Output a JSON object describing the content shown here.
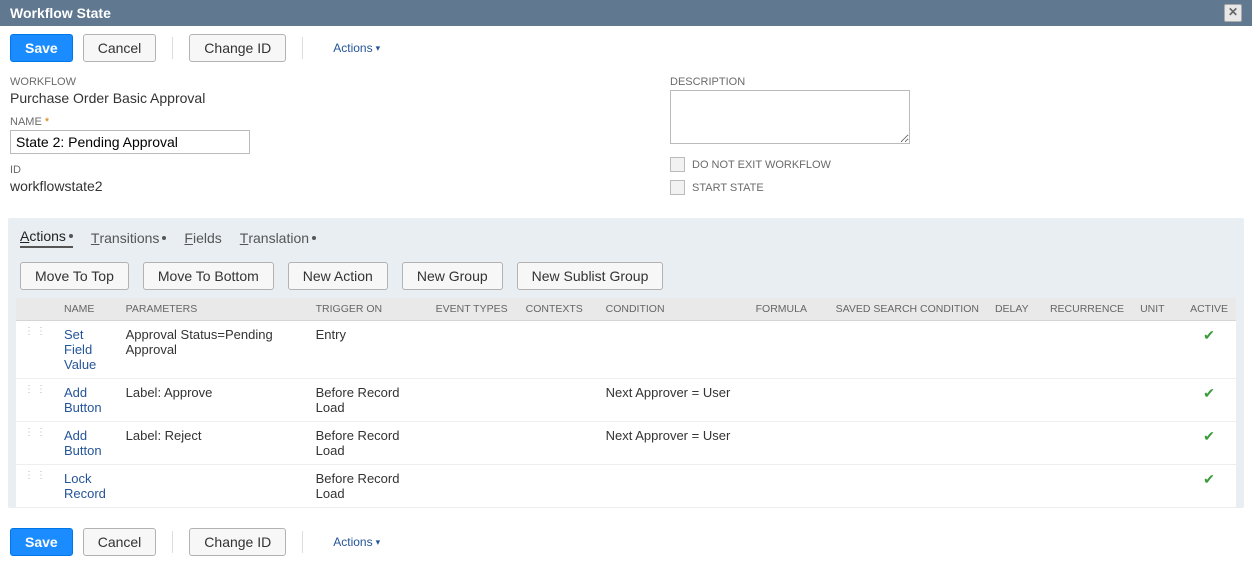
{
  "titlebar": {
    "title": "Workflow State"
  },
  "toolbar": {
    "save_label": "Save",
    "cancel_label": "Cancel",
    "changeid_label": "Change ID",
    "actions_label": "Actions"
  },
  "form": {
    "workflow_label": "WORKFLOW",
    "workflow_value": "Purchase Order Basic Approval",
    "name_label": "NAME",
    "name_value": "State 2: Pending Approval",
    "id_label": "ID",
    "id_value": "workflowstate2",
    "description_label": "DESCRIPTION",
    "description_value": "",
    "donotexit_label": "DO NOT EXIT WORKFLOW",
    "startstate_label": "START STATE"
  },
  "tabs": [
    {
      "label": "Actions",
      "underline_char": "A",
      "rest": "ctions",
      "dot": true,
      "active": true
    },
    {
      "label": "Transitions",
      "underline_char": "T",
      "rest": "ransitions",
      "dot": true,
      "active": false
    },
    {
      "label": "Fields",
      "underline_char": "F",
      "rest": "ields",
      "dot": false,
      "active": false
    },
    {
      "label": "Translation",
      "underline_char": "T",
      "rest": "ranslation",
      "dot": true,
      "active": false
    }
  ],
  "subtoolbar": {
    "movetop": "Move To Top",
    "movebottom": "Move To Bottom",
    "newaction": "New Action",
    "newgroup": "New Group",
    "newsublist": "New Sublist Group"
  },
  "grid": {
    "headers": {
      "name": "NAME",
      "parameters": "PARAMETERS",
      "triggeron": "TRIGGER ON",
      "eventtypes": "EVENT TYPES",
      "contexts": "CONTEXTS",
      "condition": "CONDITION",
      "formula": "FORMULA",
      "ssc": "SAVED SEARCH CONDITION",
      "delay": "DELAY",
      "recurrence": "RECURRENCE",
      "unit": "UNIT",
      "active": "ACTIVE"
    },
    "rows": [
      {
        "name": "Set Field Value",
        "parameters": "Approval Status=Pending Approval",
        "trigger": "Entry",
        "condition": "",
        "active": true
      },
      {
        "name": "Add Button",
        "parameters": "Label: Approve",
        "trigger": "Before Record Load",
        "condition": "Next Approver = User",
        "active": true
      },
      {
        "name": "Add Button",
        "parameters": "Label: Reject",
        "trigger": "Before Record Load",
        "condition": "Next Approver = User",
        "active": true
      },
      {
        "name": "Lock Record",
        "parameters": "",
        "trigger": "Before Record Load",
        "condition": "",
        "active": true
      }
    ]
  }
}
